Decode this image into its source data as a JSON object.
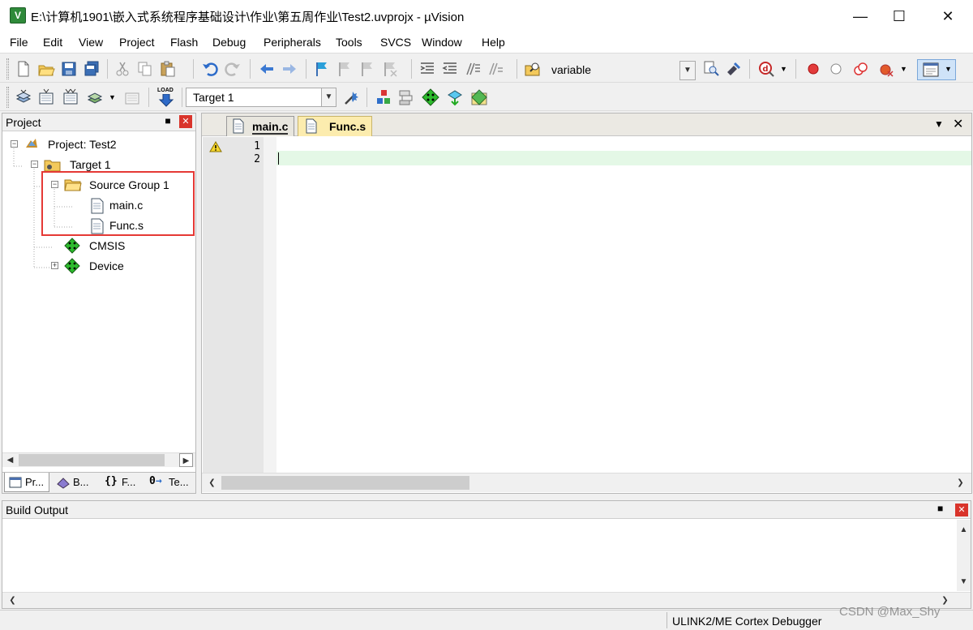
{
  "window": {
    "title": "E:\\计算机1901\\嵌入式系统程序基础设计\\作业\\第五周作业\\Test2.uvprojx - µVision",
    "app_icon_text": "V"
  },
  "menu": [
    "File",
    "Edit",
    "View",
    "Project",
    "Flash",
    "Debug",
    "Peripherals",
    "Tools",
    "SVCS",
    "Window",
    "Help"
  ],
  "toolbar1": {
    "find_value": "variable"
  },
  "toolbar2": {
    "target_value": "Target 1",
    "load_label": "LOAD"
  },
  "project_panel": {
    "title": "Project",
    "tree": [
      {
        "label": "Project: Test2"
      },
      {
        "label": "Target 1"
      },
      {
        "label": "Source Group 1"
      },
      {
        "label": "main.c"
      },
      {
        "label": "Func.s"
      },
      {
        "label": "CMSIS"
      },
      {
        "label": "Device"
      }
    ],
    "tabs": [
      {
        "label": "Pr..."
      },
      {
        "label": "B..."
      },
      {
        "label": "F..."
      },
      {
        "label": "Te..."
      }
    ]
  },
  "editor": {
    "tabs": [
      {
        "label": "main.c",
        "active": true
      },
      {
        "label": "Func.s",
        "active": false
      }
    ],
    "line_numbers": [
      "1",
      "2"
    ]
  },
  "build_output": {
    "title": "Build Output"
  },
  "status": {
    "debugger": "ULINK2/ME Cortex Debugger"
  },
  "watermark": "CSDN @Max_Shy",
  "colors": {
    "highlight": "#e53935",
    "current_line": "#e4f8e6",
    "active_tab": "#e8e6de",
    "inactive_tab": "#fcecae"
  }
}
